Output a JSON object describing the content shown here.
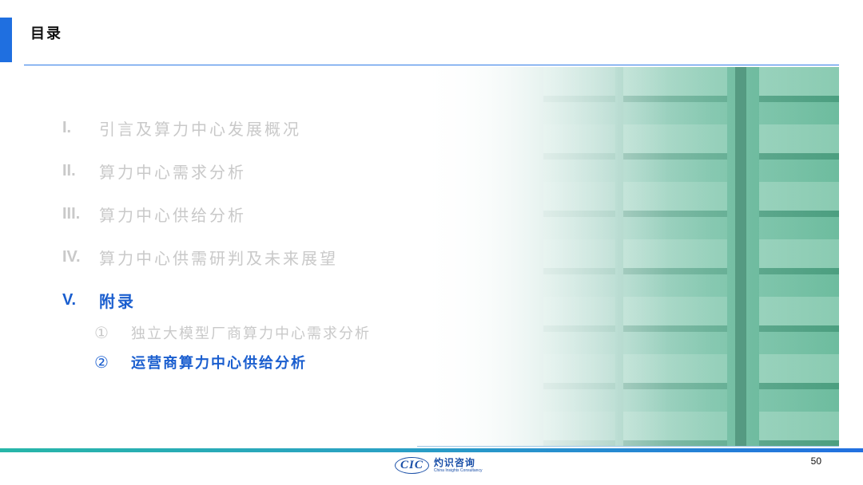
{
  "header": {
    "title": "目录"
  },
  "toc": [
    {
      "num": "I.",
      "label": "引言及算力中心发展概况"
    },
    {
      "num": "II.",
      "label": "算力中心需求分析"
    },
    {
      "num": "III.",
      "label": "算力中心供给分析"
    },
    {
      "num": "IV.",
      "label": "算力中心供需研判及未来展望"
    },
    {
      "num": "V.",
      "label": "附录"
    }
  ],
  "appendix_items": [
    {
      "num": "①",
      "label": "独立大模型厂商算力中心需求分析"
    },
    {
      "num": "②",
      "label": "运营商算力中心供给分析"
    }
  ],
  "footer": {
    "logo_mark": "CIC",
    "logo_cn": "灼识咨询",
    "logo_en": "China Insights Consultancy",
    "page_number": "50"
  },
  "colors": {
    "accent": "#1f6fe0",
    "active_text": "#1a5ecf",
    "inactive_text": "#c9c9c9"
  }
}
